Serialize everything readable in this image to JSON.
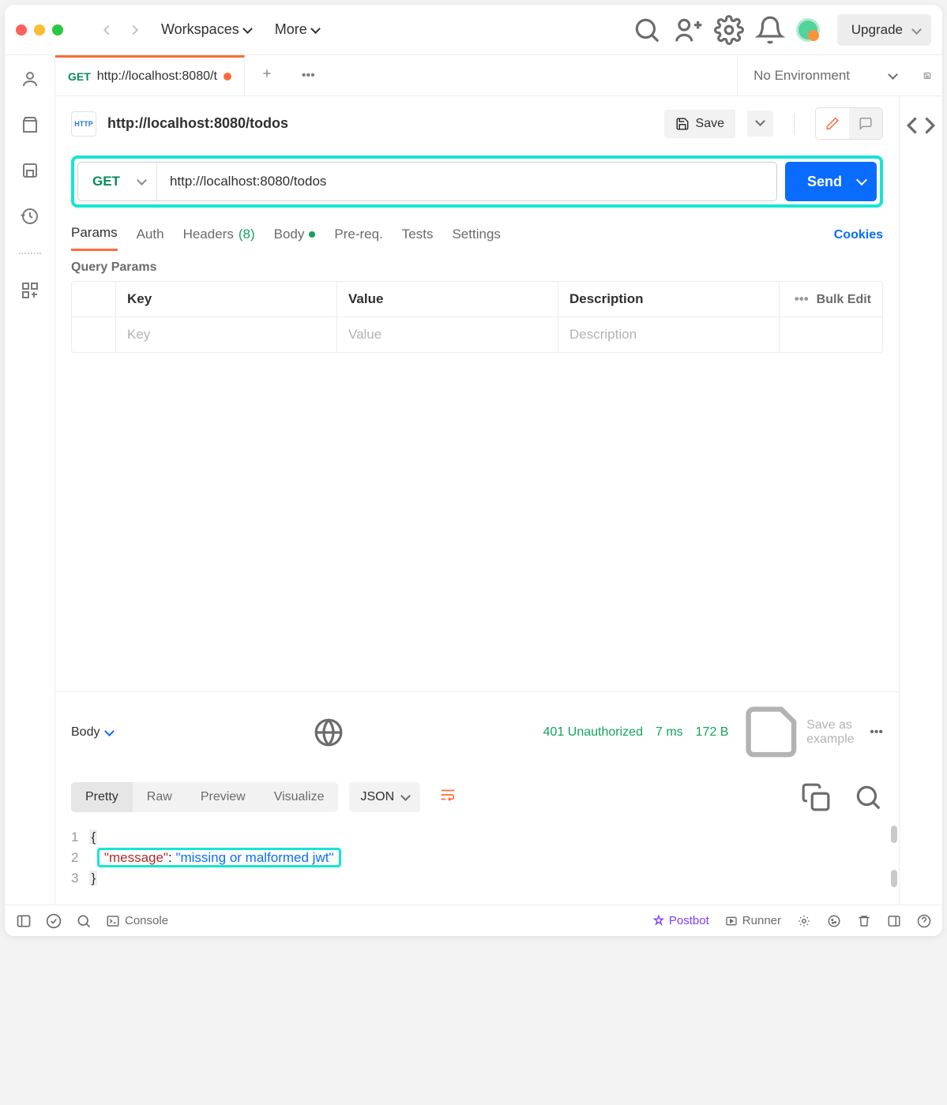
{
  "menu": {
    "workspaces": "Workspaces",
    "more": "More",
    "upgrade": "Upgrade"
  },
  "env": {
    "selected": "No Environment"
  },
  "tab": {
    "method": "GET",
    "title": "http://localhost:8080/t"
  },
  "request": {
    "title": "http://localhost:8080/todos",
    "method": "GET",
    "url": "http://localhost:8080/todos",
    "save": "Save",
    "send": "Send",
    "tabs": {
      "params": "Params",
      "auth": "Auth",
      "headers": "Headers",
      "headers_count": "(8)",
      "body": "Body",
      "prereq": "Pre-req.",
      "tests": "Tests",
      "settings": "Settings"
    },
    "cookies": "Cookies",
    "query_params_title": "Query Params",
    "table": {
      "key": "Key",
      "value": "Value",
      "description": "Description",
      "bulk": "Bulk Edit",
      "ph_key": "Key",
      "ph_value": "Value",
      "ph_desc": "Description"
    }
  },
  "response": {
    "body_label": "Body",
    "status": "401 Unauthorized",
    "time": "7 ms",
    "size": "172 B",
    "save_example": "Save as example",
    "views": {
      "pretty": "Pretty",
      "raw": "Raw",
      "preview": "Preview",
      "visualize": "Visualize"
    },
    "format": "JSON",
    "lines": [
      "1",
      "2",
      "3"
    ],
    "json": {
      "key": "\"message\"",
      "sep": ": ",
      "val": "\"missing or malformed jwt\""
    }
  },
  "footer": {
    "console": "Console",
    "postbot": "Postbot",
    "runner": "Runner"
  }
}
